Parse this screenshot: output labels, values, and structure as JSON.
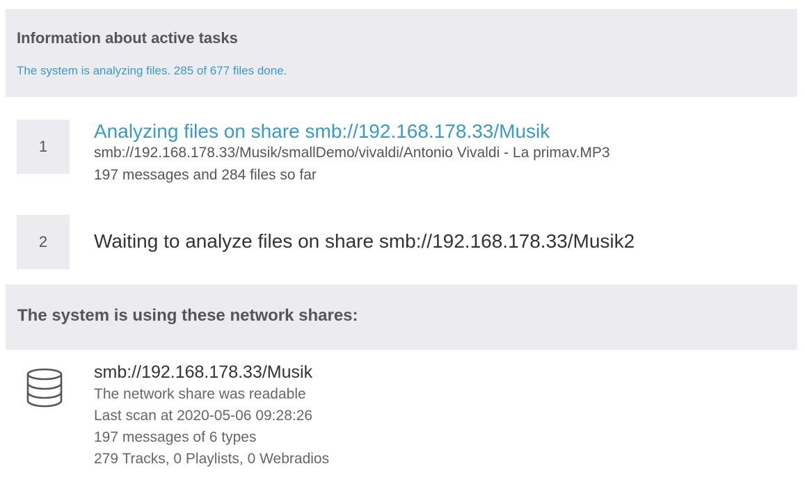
{
  "active_tasks": {
    "title": "Information about active tasks",
    "status": "The system is analyzing files. 285 of 677 files done.",
    "tasks": [
      {
        "number": "1",
        "title": "Analyzing files on share smb://192.168.178.33/Musik",
        "current_file": "smb://192.168.178.33/Musik/smallDemo/vivaldi/Antonio Vivaldi - La primav.MP3",
        "progress": "197 messages and 284 files so far"
      },
      {
        "number": "2",
        "title": "Waiting to analyze files on share smb://192.168.178.33/Musik2"
      }
    ]
  },
  "network_shares": {
    "title": "The system is using these network shares:",
    "shares": [
      {
        "icon": "database-icon",
        "name": "smb://192.168.178.33/Musik",
        "state": "The network share was readable",
        "last_scan": "Last scan at 2020-05-06 09:28:26",
        "messages": "197 messages of 6 types",
        "counts": "279 Tracks, 0 Playlists, 0 Webradios"
      }
    ]
  },
  "colors": {
    "accent": "#3a9ac4",
    "panel_background": "#ebebf0",
    "text": "#555555"
  }
}
